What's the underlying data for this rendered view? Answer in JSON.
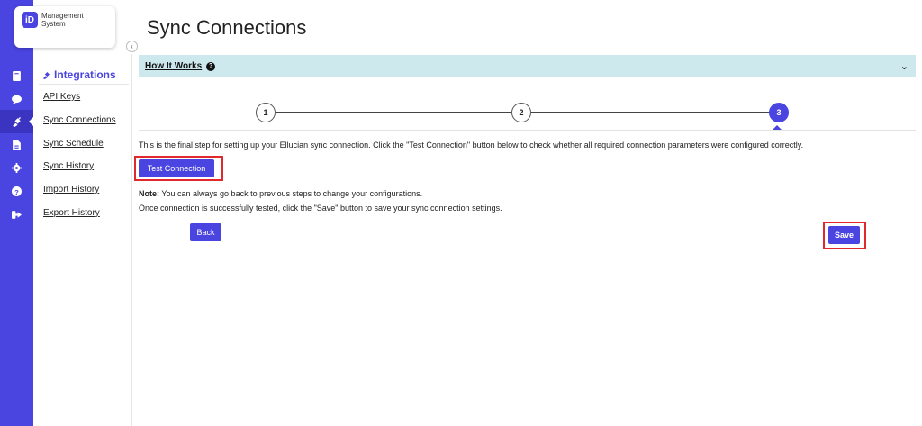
{
  "app": {
    "logo_mark": "iD",
    "logo_text": "Management System"
  },
  "rail": {
    "items": [
      {
        "icon": "address-book-icon"
      },
      {
        "icon": "chat-icon"
      },
      {
        "icon": "plug-icon",
        "active": true
      },
      {
        "icon": "document-icon"
      },
      {
        "icon": "gear-icon"
      },
      {
        "icon": "help-circle-icon"
      },
      {
        "icon": "sign-out-icon"
      }
    ]
  },
  "sidebar": {
    "heading": "Integrations",
    "items": [
      {
        "label": "API Keys"
      },
      {
        "label": "Sync Connections"
      },
      {
        "label": "Sync Schedule"
      },
      {
        "label": "Sync History"
      },
      {
        "label": "Import History"
      },
      {
        "label": "Export History"
      }
    ]
  },
  "main": {
    "title": "Sync Connections",
    "accordion_label": "How It Works",
    "steps": [
      "1",
      "2",
      "3"
    ],
    "active_step": 3,
    "description": "This is the final step for setting up your Ellucian sync connection. Click the \"Test Connection\" button below to check whether all required connection parameters were configured correctly.",
    "test_button": "Test Connection",
    "note_label": "Note:",
    "note_text": " You can always go back to previous steps to change your configurations.",
    "note_line2": "Once connection is successfully tested, click the \"Save\" button to save your sync connection settings.",
    "back_button": "Back",
    "save_button": "Save"
  },
  "colors": {
    "primary": "#4a44e0",
    "accordion_bg": "#cde9ee",
    "highlight": "#e0282d"
  }
}
